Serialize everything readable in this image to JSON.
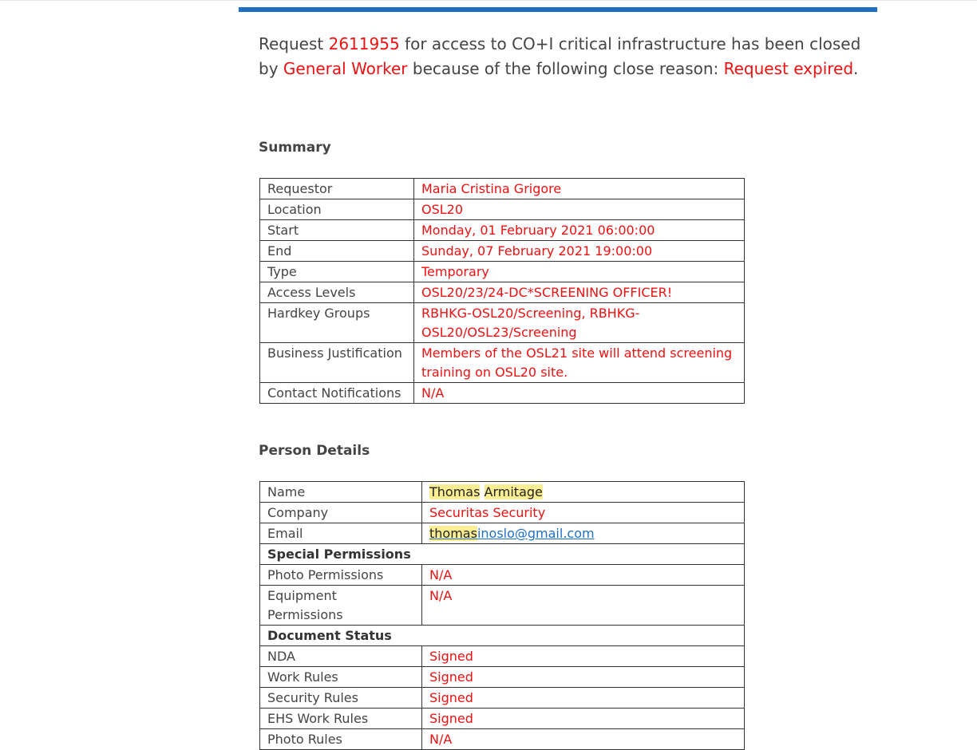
{
  "message": {
    "prefix": "Request ",
    "request_id": "2611955",
    "middle": " for access to CO+I critical infrastructure has been closed by ",
    "closed_by": "General Worker",
    "reason_intro": " because of the following close reason: ",
    "close_reason": "Request expired",
    "suffix": "."
  },
  "summary": {
    "title": "Summary",
    "rows": [
      {
        "label": "Requestor",
        "value": "Maria Cristina Grigore"
      },
      {
        "label": "Location",
        "value": "OSL20"
      },
      {
        "label": "Start",
        "value": "Monday, 01 February 2021 06:00:00"
      },
      {
        "label": "End",
        "value": "Sunday, 07 February 2021 19:00:00"
      },
      {
        "label": "Type",
        "value": "Temporary"
      },
      {
        "label": "Access Levels",
        "value": "OSL20/23/24-DC*SCREENING OFFICER!"
      },
      {
        "label": "Hardkey Groups",
        "value": "RBHKG-OSL20/Screening, RBHKG-OSL20/OSL23/Screening"
      },
      {
        "label": "Business Justification",
        "value": "Members of the OSL21 site will attend screening training on OSL20 site."
      },
      {
        "label": "Contact Notifications",
        "value": "N/A"
      }
    ]
  },
  "person": {
    "title": "Person Details",
    "name_label": "Name",
    "first_name": "Thomas",
    "last_name": "Armitage",
    "company_label": "Company",
    "company": "Securitas Security",
    "email_label": "Email",
    "email_highlight": "thomas",
    "email_rest": "inoslo@gmail.com",
    "special_permissions_header": "Special Permissions",
    "photo_permissions_label": "Photo Permissions",
    "photo_permissions": "N/A",
    "equipment_permissions_label": "Equipment Permissions",
    "equipment_permissions": "N/A",
    "document_status_header": "Document Status",
    "documents": [
      {
        "label": "NDA",
        "value": "Signed"
      },
      {
        "label": "Work Rules",
        "value": "Signed"
      },
      {
        "label": "Security Rules",
        "value": "Signed"
      },
      {
        "label": "EHS Work Rules",
        "value": "Signed"
      },
      {
        "label": "Photo Rules",
        "value": "N/A"
      }
    ]
  },
  "colors": {
    "accent_blue": "#1f6fc5",
    "value_red": "#ee1111",
    "highlight_yellow": "#fbee92"
  }
}
